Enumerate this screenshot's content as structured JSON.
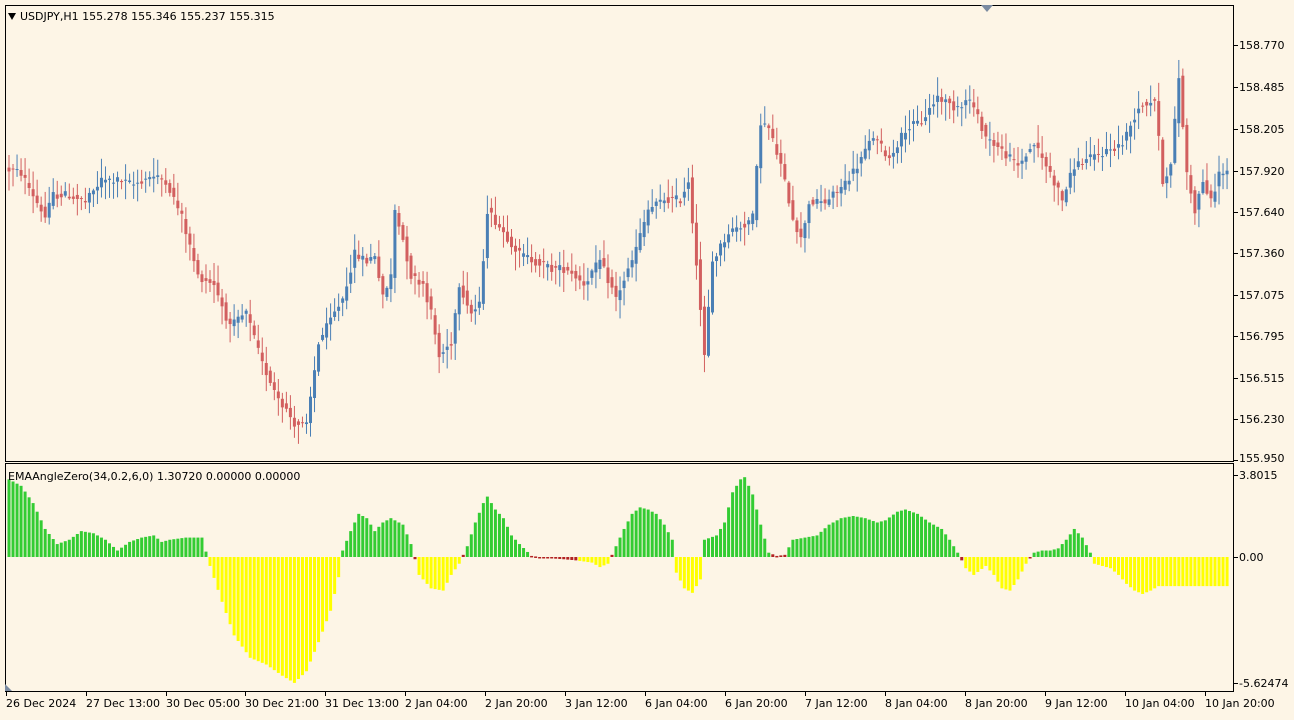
{
  "chart": {
    "symbol_label": "USDJPY,H1  155.278 155.346 155.237 155.315",
    "indicator_label": "EMAAngleZero(34,0.2,6,0) 1.30720 0.00000 0.00000",
    "price_axis": [
      "158.770",
      "158.485",
      "158.205",
      "157.920",
      "157.640",
      "157.360",
      "157.075",
      "156.795",
      "156.515",
      "156.230",
      "155.950"
    ],
    "indicator_axis": [
      "3.8015",
      "0.00",
      "-5.62474"
    ],
    "time_axis": [
      "26 Dec 2024",
      "27 Dec 13:00",
      "30 Dec 05:00",
      "30 Dec 21:00",
      "31 Dec 13:00",
      "2 Jan 04:00",
      "2 Jan 20:00",
      "3 Jan 12:00",
      "6 Jan 04:00",
      "6 Jan 20:00",
      "7 Jan 12:00",
      "8 Jan 04:00",
      "8 Jan 20:00",
      "9 Jan 12:00",
      "10 Jan 04:00",
      "10 Jan 20:00"
    ],
    "colors": {
      "background": "#fdf5e6",
      "bull_candle": "#4a7fb5",
      "bear_candle": "#d25f5f",
      "hist_up": "#33cc33",
      "hist_down": "#ffff00",
      "hist_flat": "#b22222"
    }
  },
  "chart_data": [
    {
      "type": "candlestick",
      "title": "USDJPY,H1",
      "ylim": [
        155.95,
        158.77
      ],
      "keypoints": [
        [
          0,
          157.93
        ],
        [
          4,
          157.9
        ],
        [
          8,
          157.7
        ],
        [
          10,
          157.6
        ],
        [
          12,
          157.75
        ],
        [
          16,
          157.75
        ],
        [
          20,
          157.7
        ],
        [
          24,
          157.85
        ],
        [
          28,
          157.85
        ],
        [
          32,
          157.82
        ],
        [
          36,
          157.88
        ],
        [
          40,
          157.85
        ],
        [
          44,
          157.6
        ],
        [
          48,
          157.2
        ],
        [
          52,
          157.15
        ],
        [
          56,
          156.85
        ],
        [
          60,
          156.95
        ],
        [
          64,
          156.6
        ],
        [
          68,
          156.38
        ],
        [
          72,
          156.2
        ],
        [
          75,
          156.18
        ],
        [
          78,
          156.75
        ],
        [
          82,
          156.95
        ],
        [
          84,
          157.05
        ],
        [
          87,
          157.35
        ],
        [
          90,
          157.3
        ],
        [
          92,
          157.35
        ],
        [
          94,
          157.05
        ],
        [
          96,
          157.2
        ],
        [
          97,
          157.65
        ],
        [
          99,
          157.45
        ],
        [
          101,
          157.2
        ],
        [
          104,
          157.15
        ],
        [
          106,
          156.95
        ],
        [
          108,
          156.65
        ],
        [
          111,
          156.75
        ],
        [
          113,
          157.15
        ],
        [
          116,
          156.95
        ],
        [
          118,
          157.0
        ],
        [
          120,
          157.65
        ],
        [
          124,
          157.5
        ],
        [
          128,
          157.35
        ],
        [
          132,
          157.3
        ],
        [
          136,
          157.25
        ],
        [
          140,
          157.25
        ],
        [
          144,
          157.15
        ],
        [
          148,
          157.3
        ],
        [
          152,
          157.05
        ],
        [
          156,
          157.3
        ],
        [
          160,
          157.65
        ],
        [
          164,
          157.72
        ],
        [
          168,
          157.72
        ],
        [
          170,
          157.85
        ],
        [
          172,
          157.3
        ],
        [
          174,
          156.65
        ],
        [
          176,
          157.3
        ],
        [
          180,
          157.5
        ],
        [
          184,
          157.55
        ],
        [
          186,
          157.6
        ],
        [
          188,
          158.25
        ],
        [
          190,
          158.2
        ],
        [
          193,
          157.95
        ],
        [
          196,
          157.6
        ],
        [
          198,
          157.45
        ],
        [
          200,
          157.7
        ],
        [
          204,
          157.7
        ],
        [
          208,
          157.8
        ],
        [
          212,
          157.95
        ],
        [
          216,
          158.15
        ],
        [
          220,
          158.0
        ],
        [
          224,
          158.2
        ],
        [
          228,
          158.25
        ],
        [
          232,
          158.42
        ],
        [
          236,
          158.35
        ],
        [
          240,
          158.4
        ],
        [
          244,
          158.15
        ],
        [
          248,
          158.05
        ],
        [
          252,
          157.95
        ],
        [
          256,
          158.1
        ],
        [
          260,
          157.9
        ],
        [
          263,
          157.72
        ],
        [
          266,
          157.95
        ],
        [
          270,
          158.0
        ],
        [
          274,
          158.05
        ],
        [
          278,
          158.1
        ],
        [
          282,
          158.35
        ],
        [
          286,
          158.4
        ],
        [
          288,
          157.85
        ],
        [
          290,
          157.95
        ],
        [
          292,
          158.55
        ],
        [
          294,
          157.9
        ],
        [
          296,
          157.65
        ],
        [
          298,
          157.85
        ],
        [
          300,
          157.7
        ],
        [
          302,
          157.9
        ]
      ]
    },
    {
      "type": "bar",
      "title": "EMAAngleZero(34,0.2,6,0)",
      "ylim": [
        -5.62474,
        3.8015
      ],
      "up_color_when": "value > 0.15",
      "down_color_when": "value < -0.15",
      "keypoints": [
        [
          0,
          3.6
        ],
        [
          3,
          3.3
        ],
        [
          6,
          2.5
        ],
        [
          9,
          1.3
        ],
        [
          12,
          0.6
        ],
        [
          15,
          0.8
        ],
        [
          18,
          1.2
        ],
        [
          21,
          1.1
        ],
        [
          24,
          0.8
        ],
        [
          27,
          0.3
        ],
        [
          30,
          0.7
        ],
        [
          33,
          0.9
        ],
        [
          36,
          1.0
        ],
        [
          38,
          0.7
        ],
        [
          40,
          0.8
        ],
        [
          44,
          0.9
        ],
        [
          48,
          0.9
        ],
        [
          50,
          -0.4
        ],
        [
          53,
          -2.0
        ],
        [
          56,
          -3.5
        ],
        [
          60,
          -4.5
        ],
        [
          64,
          -4.8
        ],
        [
          68,
          -5.3
        ],
        [
          71,
          -5.62
        ],
        [
          74,
          -5.1
        ],
        [
          77,
          -3.8
        ],
        [
          80,
          -2.4
        ],
        [
          82,
          -0.9
        ],
        [
          83,
          0.3
        ],
        [
          85,
          1.2
        ],
        [
          87,
          2.0
        ],
        [
          89,
          1.8
        ],
        [
          91,
          1.2
        ],
        [
          93,
          1.6
        ],
        [
          95,
          1.8
        ],
        [
          98,
          1.5
        ],
        [
          100,
          0.6
        ],
        [
          102,
          -0.8
        ],
        [
          105,
          -1.4
        ],
        [
          108,
          -1.5
        ],
        [
          110,
          -0.8
        ],
        [
          112,
          -0.3
        ],
        [
          114,
          0.5
        ],
        [
          116,
          1.6
        ],
        [
          118,
          2.5
        ],
        [
          119,
          2.8
        ],
        [
          121,
          2.2
        ],
        [
          123,
          1.8
        ],
        [
          125,
          1.0
        ],
        [
          127,
          0.6
        ],
        [
          130,
          0.05
        ],
        [
          134,
          -0.05
        ],
        [
          138,
          -0.1
        ],
        [
          141,
          -0.15
        ],
        [
          143,
          -0.2
        ],
        [
          145,
          -0.25
        ],
        [
          147,
          -0.45
        ],
        [
          149,
          -0.3
        ],
        [
          151,
          0.5
        ],
        [
          153,
          1.3
        ],
        [
          155,
          2.0
        ],
        [
          157,
          2.3
        ],
        [
          159,
          2.2
        ],
        [
          161,
          2.0
        ],
        [
          163,
          1.5
        ],
        [
          165,
          0.8
        ],
        [
          166,
          -0.7
        ],
        [
          168,
          -1.4
        ],
        [
          170,
          -1.6
        ],
        [
          172,
          -1.0
        ],
        [
          173,
          0.8
        ],
        [
          176,
          1.0
        ],
        [
          178,
          1.6
        ],
        [
          180,
          3.0
        ],
        [
          182,
          3.6
        ],
        [
          183,
          3.7
        ],
        [
          185,
          2.9
        ],
        [
          187,
          1.5
        ],
        [
          189,
          0.2
        ],
        [
          191,
          0.05
        ],
        [
          193,
          0.1
        ],
        [
          195,
          0.8
        ],
        [
          198,
          0.9
        ],
        [
          201,
          1.0
        ],
        [
          204,
          1.5
        ],
        [
          207,
          1.8
        ],
        [
          210,
          1.9
        ],
        [
          213,
          1.8
        ],
        [
          216,
          1.6
        ],
        [
          218,
          1.7
        ],
        [
          221,
          2.1
        ],
        [
          223,
          2.2
        ],
        [
          226,
          2.0
        ],
        [
          229,
          1.6
        ],
        [
          232,
          1.3
        ],
        [
          234,
          0.8
        ],
        [
          236,
          0.2
        ],
        [
          238,
          -0.5
        ],
        [
          240,
          -0.8
        ],
        [
          243,
          -0.4
        ],
        [
          245,
          -0.8
        ],
        [
          247,
          -1.4
        ],
        [
          249,
          -1.5
        ],
        [
          251,
          -1.0
        ],
        [
          253,
          -0.3
        ],
        [
          255,
          0.2
        ],
        [
          257,
          0.3
        ],
        [
          259,
          0.3
        ],
        [
          261,
          0.4
        ],
        [
          263,
          0.8
        ],
        [
          265,
          1.3
        ],
        [
          267,
          0.9
        ],
        [
          269,
          0.2
        ],
        [
          270,
          -0.3
        ],
        [
          272,
          -0.4
        ],
        [
          274,
          -0.5
        ],
        [
          276,
          -0.8
        ],
        [
          278,
          -1.2
        ],
        [
          280,
          -1.5
        ],
        [
          282,
          -1.65
        ],
        [
          284,
          -1.5
        ],
        [
          286,
          -1.3
        ]
      ]
    }
  ]
}
